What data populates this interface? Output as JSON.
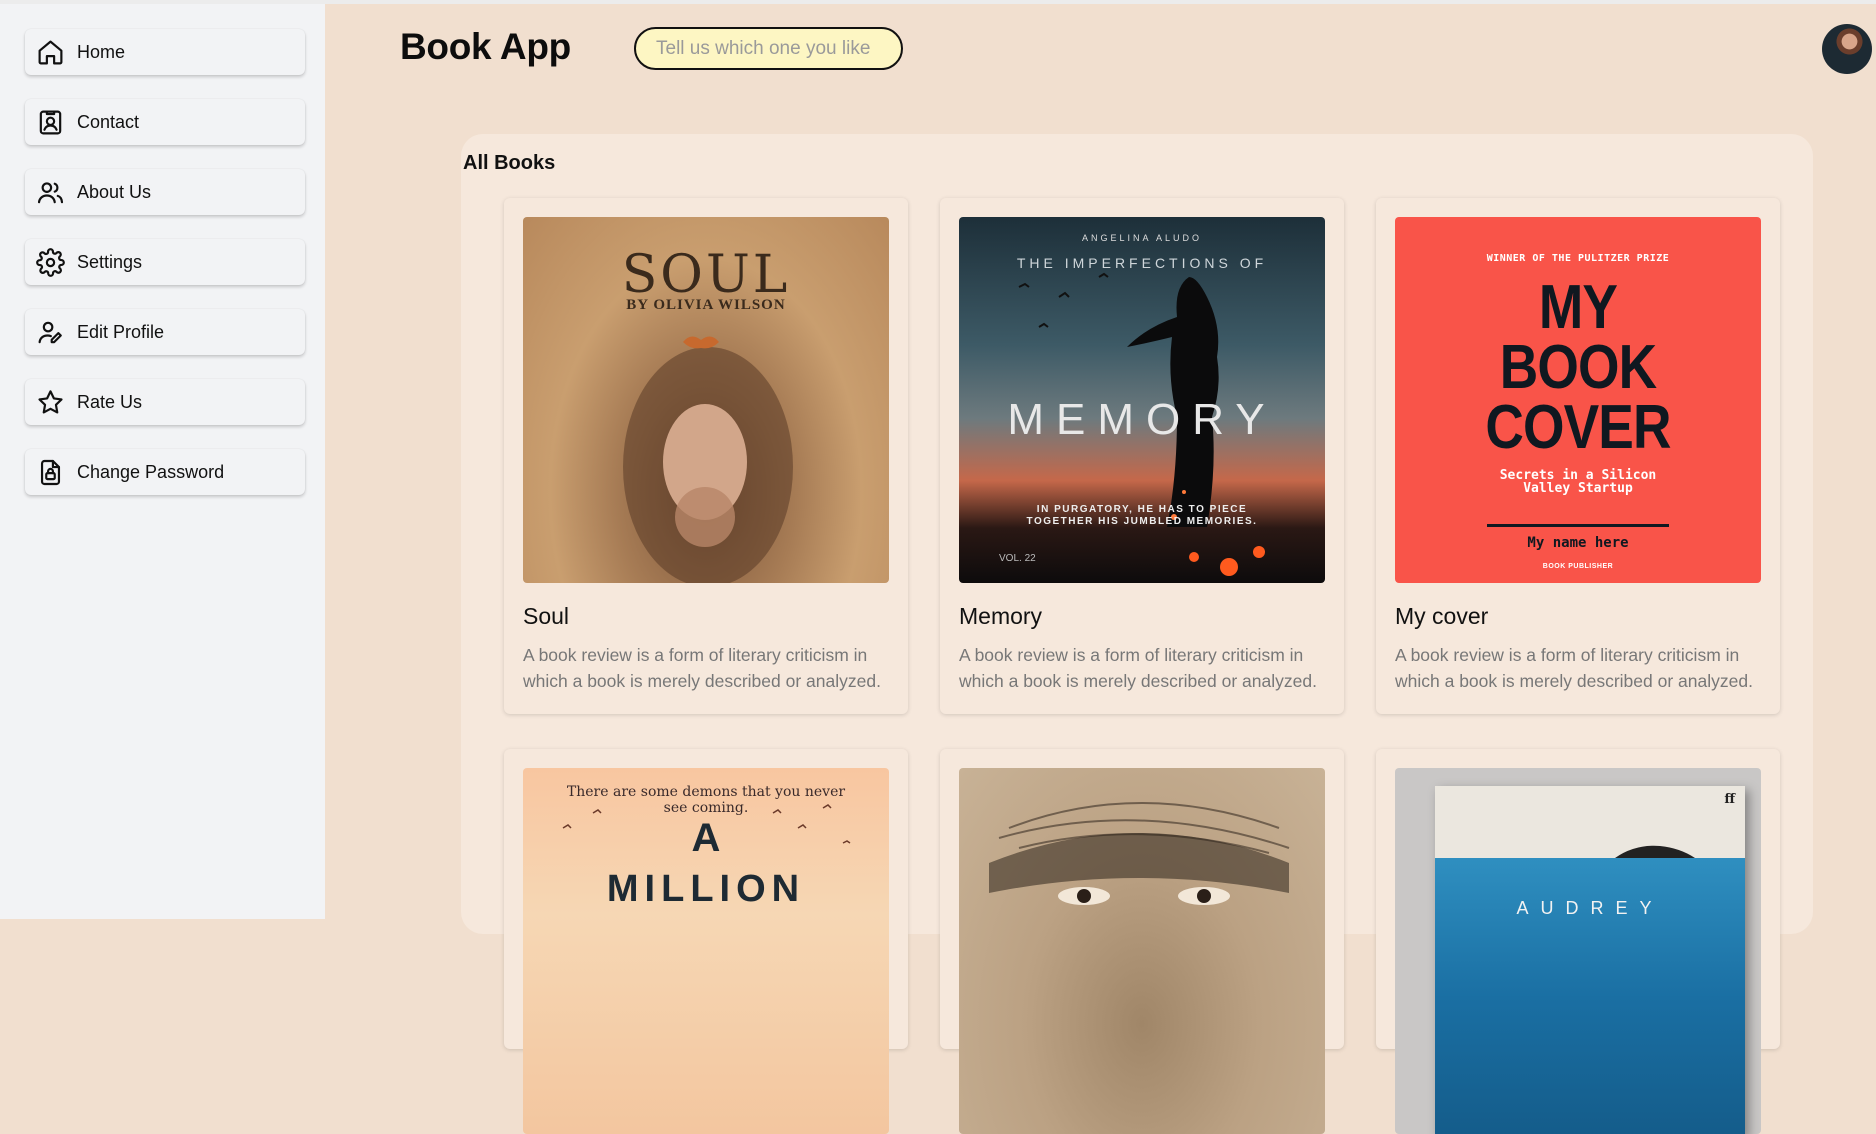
{
  "sidebar": {
    "items": [
      {
        "label": "Home",
        "icon": "home-icon"
      },
      {
        "label": "Contact",
        "icon": "contact-icon"
      },
      {
        "label": "About Us",
        "icon": "users-icon"
      },
      {
        "label": "Settings",
        "icon": "gear-icon"
      },
      {
        "label": "Edit Profile",
        "icon": "edit-user-icon"
      },
      {
        "label": "Rate Us",
        "icon": "star-icon"
      },
      {
        "label": "Change Password",
        "icon": "lock-icon"
      }
    ]
  },
  "header": {
    "title": "Book App",
    "search_placeholder": "Tell us which one you like"
  },
  "main": {
    "section_title": "All Books",
    "books": [
      {
        "title": "Soul",
        "description": "A book review is a form of literary criticism in which a book is merely described or analyzed.",
        "cover": {
          "headline": "SOUL",
          "author": "BY OLIVIA WILSON"
        }
      },
      {
        "title": "Memory",
        "description": "A book review is a form of literary criticism in which a book is merely described or analyzed.",
        "cover": {
          "author": "ANGELINA ALUDO",
          "subtitle": "THE IMPERFECTIONS OF",
          "headline": "MEMORY",
          "tagline": "IN PURGATORY, HE HAS TO PIECE TOGETHER HIS JUMBLED MEMORIES.",
          "volume": "VOL. 22"
        }
      },
      {
        "title": "My cover",
        "description": "A book review is a form of literary criticism in which a book is merely described or analyzed.",
        "cover": {
          "award": "WINNER OF THE PULITZER PRIZE",
          "headline_1": "MY",
          "headline_2": "BOOK",
          "headline_3": "COVER",
          "subtitle": "Secrets in a Silicon Valley Startup",
          "author": "My name here",
          "publisher": "BOOK PUBLISHER"
        }
      },
      {
        "cover": {
          "tagline": "There are some demons that you never see coming.",
          "headline_1": "A",
          "headline_2": "MILLION"
        }
      },
      {
        "cover": {}
      },
      {
        "cover": {
          "logo": "ff",
          "headline": "AUDREY"
        }
      }
    ]
  },
  "colors": {
    "page_bg": "#f1dfcf",
    "sidebar_bg": "#f2f3f5",
    "panel_bg": "#f6e8dc",
    "search_bg": "#fdf6c3",
    "my_cover_red": "#f95449"
  }
}
